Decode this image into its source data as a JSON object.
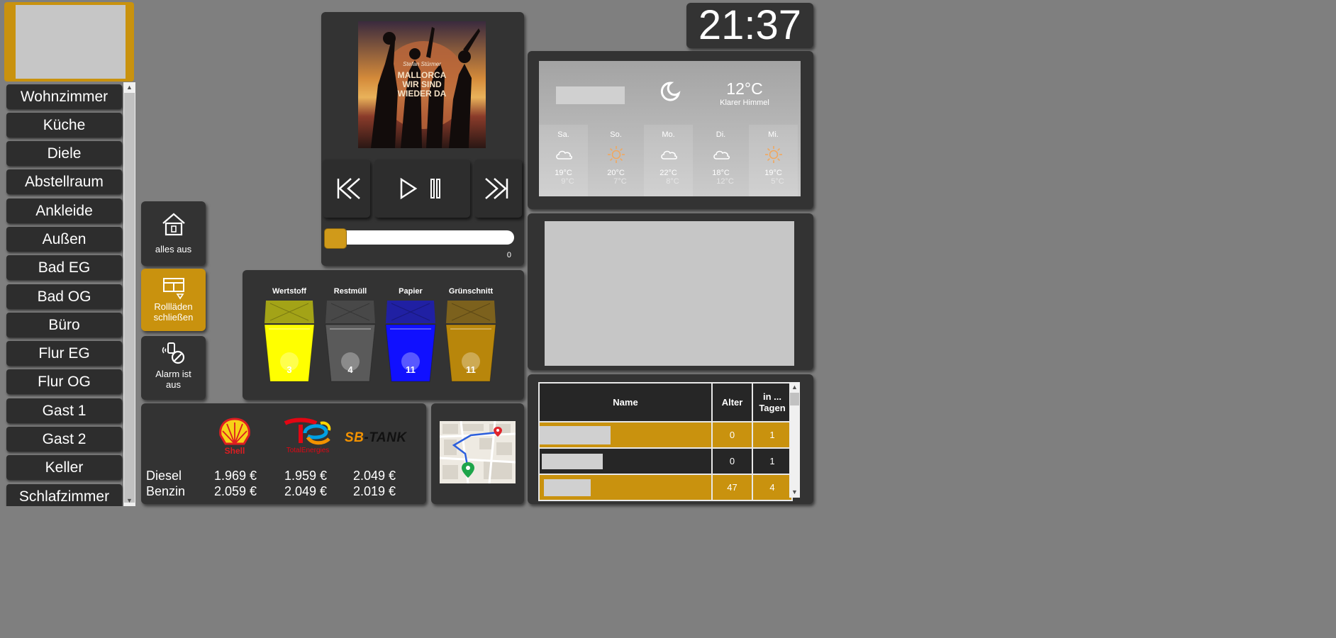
{
  "clock": "21:37",
  "rooms": [
    "Wohnzimmer",
    "Küche",
    "Diele",
    "Abstellraum",
    "Ankleide",
    "Außen",
    "Bad EG",
    "Bad OG",
    "Büro",
    "Flur EG",
    "Flur OG",
    "Gast 1",
    "Gast 2",
    "Keller",
    "Schlafzimmer"
  ],
  "actions": {
    "all_off": "alles aus",
    "shutters_line1": "Rollläden",
    "shutters_line2": "schließen",
    "alarm_line1": "Alarm ist",
    "alarm_line2": "aus"
  },
  "media": {
    "album_artist": "Stefan Stürmer",
    "album_title_lines": [
      "MALLORCA",
      "WIR SIND",
      "WIEDER DA"
    ],
    "position_value": "0",
    "progress": 0
  },
  "trash": [
    {
      "label": "Wertstoff",
      "days": "3",
      "color": "#ffff00"
    },
    {
      "label": "Restmüll",
      "days": "4",
      "color": "#5a5a5a"
    },
    {
      "label": "Papier",
      "days": "11",
      "color": "#1010ff"
    },
    {
      "label": "Grünschnitt",
      "days": "11",
      "color": "#b8860b"
    }
  ],
  "fuel": {
    "brands": [
      "Shell",
      "TotalEnergies",
      "SB-TANK"
    ],
    "rows": [
      {
        "label": "Diesel",
        "prices": [
          "1.969 €",
          "1.959 €",
          "2.049 €"
        ]
      },
      {
        "label": "Benzin",
        "prices": [
          "2.059 €",
          "2.049 €",
          "2.019 €"
        ]
      }
    ]
  },
  "weather": {
    "temp": "12°C",
    "condition": "Klarer Himmel",
    "days": [
      {
        "name": "Sa.",
        "icon": "cloud-icon",
        "high": "19°C",
        "low": "9°C"
      },
      {
        "name": "So.",
        "icon": "sun-icon",
        "high": "20°C",
        "low": "7°C"
      },
      {
        "name": "Mo.",
        "icon": "cloud-icon",
        "high": "22°C",
        "low": "8°C"
      },
      {
        "name": "Di.",
        "icon": "cloud-icon",
        "high": "18°C",
        "low": "12°C"
      },
      {
        "name": "Mi.",
        "icon": "sun-icon",
        "high": "19°C",
        "low": "5°C"
      }
    ]
  },
  "table": {
    "headers": [
      "Name",
      "Alter",
      "in ... Tagen"
    ],
    "header_in_line1": "in ...",
    "header_in_line2": "Tagen",
    "rows": [
      {
        "alter": "0",
        "tage": "1"
      },
      {
        "alter": "0",
        "tage": "1"
      },
      {
        "alter": "47",
        "tage": "4"
      }
    ]
  },
  "colors": {
    "accent": "#c9920e",
    "panel": "#333333",
    "background": "#7f7f7f"
  }
}
